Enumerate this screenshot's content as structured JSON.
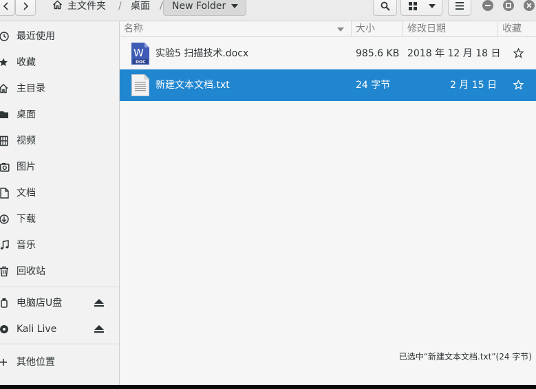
{
  "breadcrumb": {
    "home_label": "主文件夹",
    "desktop_label": "桌面",
    "current_label": "New Folder",
    "separator": "/"
  },
  "toolbar": {
    "search_icon": "search-icon",
    "view_icon": "grid-view-icon",
    "menu_icon": "hamburger-icon"
  },
  "window_controls": [
    "minimize",
    "maximize",
    "close"
  ],
  "sidebar": {
    "items": [
      {
        "label": "最近使用",
        "icon": "clock-icon"
      },
      {
        "label": "收藏",
        "icon": "star-icon"
      },
      {
        "label": "主目录",
        "icon": "home-icon"
      },
      {
        "label": "桌面",
        "icon": "folder-icon"
      },
      {
        "label": "视频",
        "icon": "film-icon"
      },
      {
        "label": "图片",
        "icon": "camera-icon"
      },
      {
        "label": "文档",
        "icon": "document-icon"
      },
      {
        "label": "下载",
        "icon": "download-icon"
      },
      {
        "label": "音乐",
        "icon": "music-icon"
      },
      {
        "label": "回收站",
        "icon": "trash-icon"
      }
    ],
    "devices": [
      {
        "label": "电脑店U盘",
        "icon": "usb-drive-icon",
        "eject": true
      },
      {
        "label": "Kali Live",
        "icon": "disc-icon",
        "eject": true
      }
    ],
    "other_label": "其他位置"
  },
  "columns": {
    "name": "名称",
    "size": "大小",
    "modified": "修改日期",
    "starred": "收藏"
  },
  "files": [
    {
      "name": "实验5 扫描技术.docx",
      "size": "985.6 KB",
      "modified": "2018 年 12 月 18 日",
      "type": "docx",
      "doc_badge": "DOC",
      "doc_letter": "W",
      "selected": false
    },
    {
      "name": "新建文本文档.txt",
      "size": "24 字节",
      "modified": "2 月 15 日",
      "type": "txt",
      "selected": true
    }
  ],
  "status_text": "已选中“新建文本文档.txt”(24 字节)",
  "colors": {
    "selection": "#2186d0",
    "sidebar_bg": "#f2f2f2",
    "main_bg": "#f6f6f6",
    "doc_icon": "#3e5cb5"
  }
}
